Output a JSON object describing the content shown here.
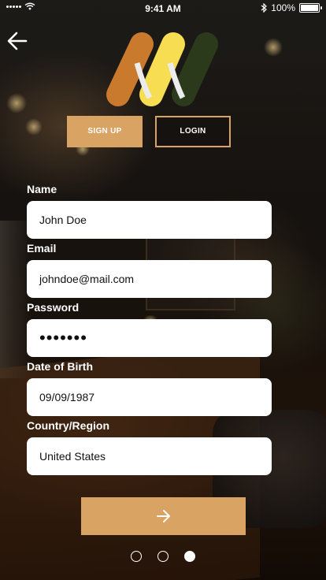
{
  "status_bar": {
    "time": "9:41 AM",
    "battery": "100%",
    "bluetooth_icon": "bluetooth-icon",
    "wifi_icon": "wifi-icon",
    "signal_icon": "cellular-signal-icon"
  },
  "header": {
    "back_icon": "arrow-left-icon",
    "logo": {
      "stripes": [
        "#c97a2c",
        "#f6dd52",
        "#2c3a1c"
      ]
    }
  },
  "tabs": {
    "signup_label": "SIGN UP",
    "login_label": "LOGIN",
    "active": "signup"
  },
  "form": {
    "name": {
      "label": "Name",
      "value": "John Doe"
    },
    "email": {
      "label": "Email",
      "value": "johndoe@mail.com"
    },
    "password": {
      "label": "Password",
      "value": "•••••••"
    },
    "dob": {
      "label": "Date of Birth",
      "value": "09/09/1987"
    },
    "country": {
      "label": "Country/Region",
      "value": "United States"
    }
  },
  "next_button": {
    "icon": "arrow-right-icon"
  },
  "pager": {
    "count": 3,
    "active_index": 2
  },
  "colors": {
    "accent": "#d9a363",
    "text": "#ffffff",
    "field_bg": "#ffffff"
  }
}
